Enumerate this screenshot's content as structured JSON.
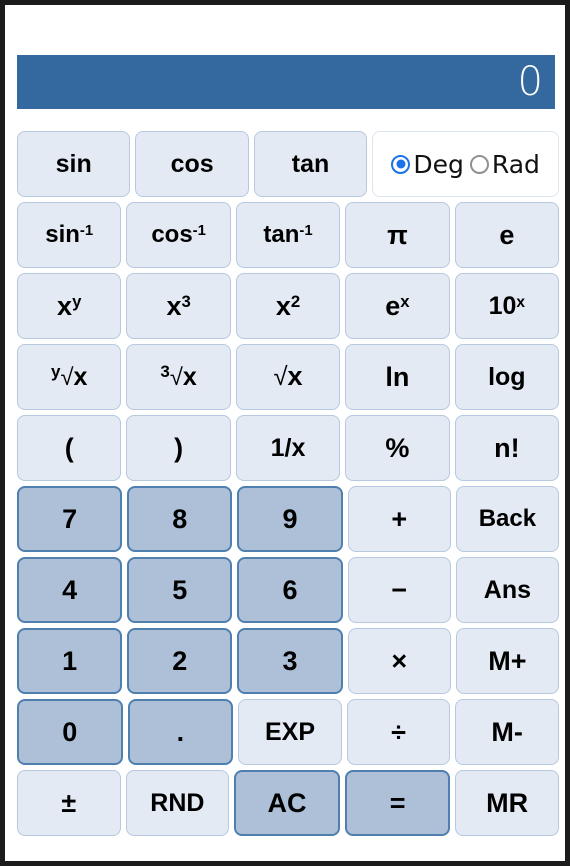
{
  "display": {
    "value": "0"
  },
  "angle_mode": {
    "selected": "Deg",
    "options": [
      {
        "label": "Deg",
        "checked": true
      },
      {
        "label": "Rad",
        "checked": false
      }
    ]
  },
  "colors": {
    "display_bg": "#34699f",
    "display_text": "#ffffff",
    "function_key_bg": "#e3eaf3",
    "function_key_border": "#b6c9df",
    "digit_key_bg": "#adc0d8",
    "digit_key_border": "#4f7faf",
    "radio_accent": "#1a73e8",
    "frame_border": "#1c1c1c",
    "page_bg": "#ffffff"
  },
  "keypad": {
    "rows": [
      {
        "name": "trig-row",
        "keys": [
          {
            "label": "sin",
            "name": "key-sin",
            "style": "function"
          },
          {
            "label": "cos",
            "name": "key-cos",
            "style": "function"
          },
          {
            "label": "tan",
            "name": "key-tan",
            "style": "function"
          }
        ],
        "has_angle_box": true
      },
      {
        "name": "inverse-trig-row",
        "keys": [
          {
            "label": "sin-1",
            "base": "sin",
            "sup": "-1",
            "name": "key-asin",
            "style": "function"
          },
          {
            "label": "cos-1",
            "base": "cos",
            "sup": "-1",
            "name": "key-acos",
            "style": "function"
          },
          {
            "label": "tan-1",
            "base": "tan",
            "sup": "-1",
            "name": "key-atan",
            "style": "function"
          },
          {
            "label": "π",
            "name": "key-pi",
            "style": "function"
          },
          {
            "label": "e",
            "name": "key-e",
            "style": "function"
          }
        ],
        "has_angle_box": false
      },
      {
        "name": "power-row",
        "keys": [
          {
            "label": "xy",
            "base": "x",
            "sup": "y",
            "name": "key-x-pow-y",
            "style": "function"
          },
          {
            "label": "x3",
            "base": "x",
            "sup": "3",
            "name": "key-x-cubed",
            "style": "function"
          },
          {
            "label": "x2",
            "base": "x",
            "sup": "2",
            "name": "key-x-squared",
            "style": "function"
          },
          {
            "label": "ex",
            "base": "e",
            "sup": "x",
            "name": "key-e-pow-x",
            "style": "function"
          },
          {
            "label": "10x",
            "base": "10",
            "sup": "x",
            "name": "key-ten-pow-x",
            "style": "function"
          }
        ],
        "has_angle_box": false
      },
      {
        "name": "root-log-row",
        "keys": [
          {
            "label": "y√x",
            "pre": "y",
            "radical": "√",
            "post": "x",
            "name": "key-nth-root",
            "style": "function"
          },
          {
            "label": "3√x",
            "pre": "3",
            "radical": "√",
            "post": "x",
            "name": "key-cube-root",
            "style": "function"
          },
          {
            "label": "√x",
            "pre": "",
            "radical": "√",
            "post": "x",
            "name": "key-square-root",
            "style": "function"
          },
          {
            "label": "ln",
            "name": "key-ln",
            "style": "function"
          },
          {
            "label": "log",
            "name": "key-log",
            "style": "function"
          }
        ],
        "has_angle_box": false
      },
      {
        "name": "paren-misc-row",
        "keys": [
          {
            "label": "(",
            "name": "key-open-paren",
            "style": "function"
          },
          {
            "label": ")",
            "name": "key-close-paren",
            "style": "function"
          },
          {
            "label": "1/x",
            "name": "key-reciprocal",
            "style": "function"
          },
          {
            "label": "%",
            "name": "key-percent",
            "style": "function"
          },
          {
            "label": "n!",
            "name": "key-factorial",
            "style": "function"
          }
        ],
        "has_angle_box": false
      },
      {
        "name": "digits-789-row",
        "keys": [
          {
            "label": "7",
            "name": "key-7",
            "style": "digit"
          },
          {
            "label": "8",
            "name": "key-8",
            "style": "digit"
          },
          {
            "label": "9",
            "name": "key-9",
            "style": "digit"
          },
          {
            "label": "+",
            "name": "key-plus",
            "style": "function"
          },
          {
            "label": "Back",
            "name": "key-backspace",
            "style": "function"
          }
        ],
        "has_angle_box": false
      },
      {
        "name": "digits-456-row",
        "keys": [
          {
            "label": "4",
            "name": "key-4",
            "style": "digit"
          },
          {
            "label": "5",
            "name": "key-5",
            "style": "digit"
          },
          {
            "label": "6",
            "name": "key-6",
            "style": "digit"
          },
          {
            "label": "−",
            "name": "key-minus",
            "style": "function"
          },
          {
            "label": "Ans",
            "name": "key-answer",
            "style": "function"
          }
        ],
        "has_angle_box": false
      },
      {
        "name": "digits-123-row",
        "keys": [
          {
            "label": "1",
            "name": "key-1",
            "style": "digit"
          },
          {
            "label": "2",
            "name": "key-2",
            "style": "digit"
          },
          {
            "label": "3",
            "name": "key-3",
            "style": "digit"
          },
          {
            "label": "×",
            "name": "key-multiply",
            "style": "function"
          },
          {
            "label": "M+",
            "name": "key-memory-add",
            "style": "function"
          }
        ],
        "has_angle_box": false
      },
      {
        "name": "zero-exp-row",
        "keys": [
          {
            "label": "0",
            "name": "key-0",
            "style": "digit"
          },
          {
            "label": ".",
            "name": "key-decimal-point",
            "style": "digit"
          },
          {
            "label": "EXP",
            "name": "key-exponent",
            "style": "function"
          },
          {
            "label": "÷",
            "name": "key-divide",
            "style": "function"
          },
          {
            "label": "M-",
            "name": "key-memory-subtract",
            "style": "function"
          }
        ],
        "has_angle_box": false
      },
      {
        "name": "bottom-row",
        "keys": [
          {
            "label": "±",
            "name": "key-sign-toggle",
            "style": "function"
          },
          {
            "label": "RND",
            "name": "key-random",
            "style": "function"
          },
          {
            "label": "AC",
            "name": "key-all-clear",
            "style": "digit"
          },
          {
            "label": "=",
            "name": "key-equals",
            "style": "digit"
          },
          {
            "label": "MR",
            "name": "key-memory-recall",
            "style": "function"
          }
        ],
        "has_angle_box": false
      }
    ]
  }
}
